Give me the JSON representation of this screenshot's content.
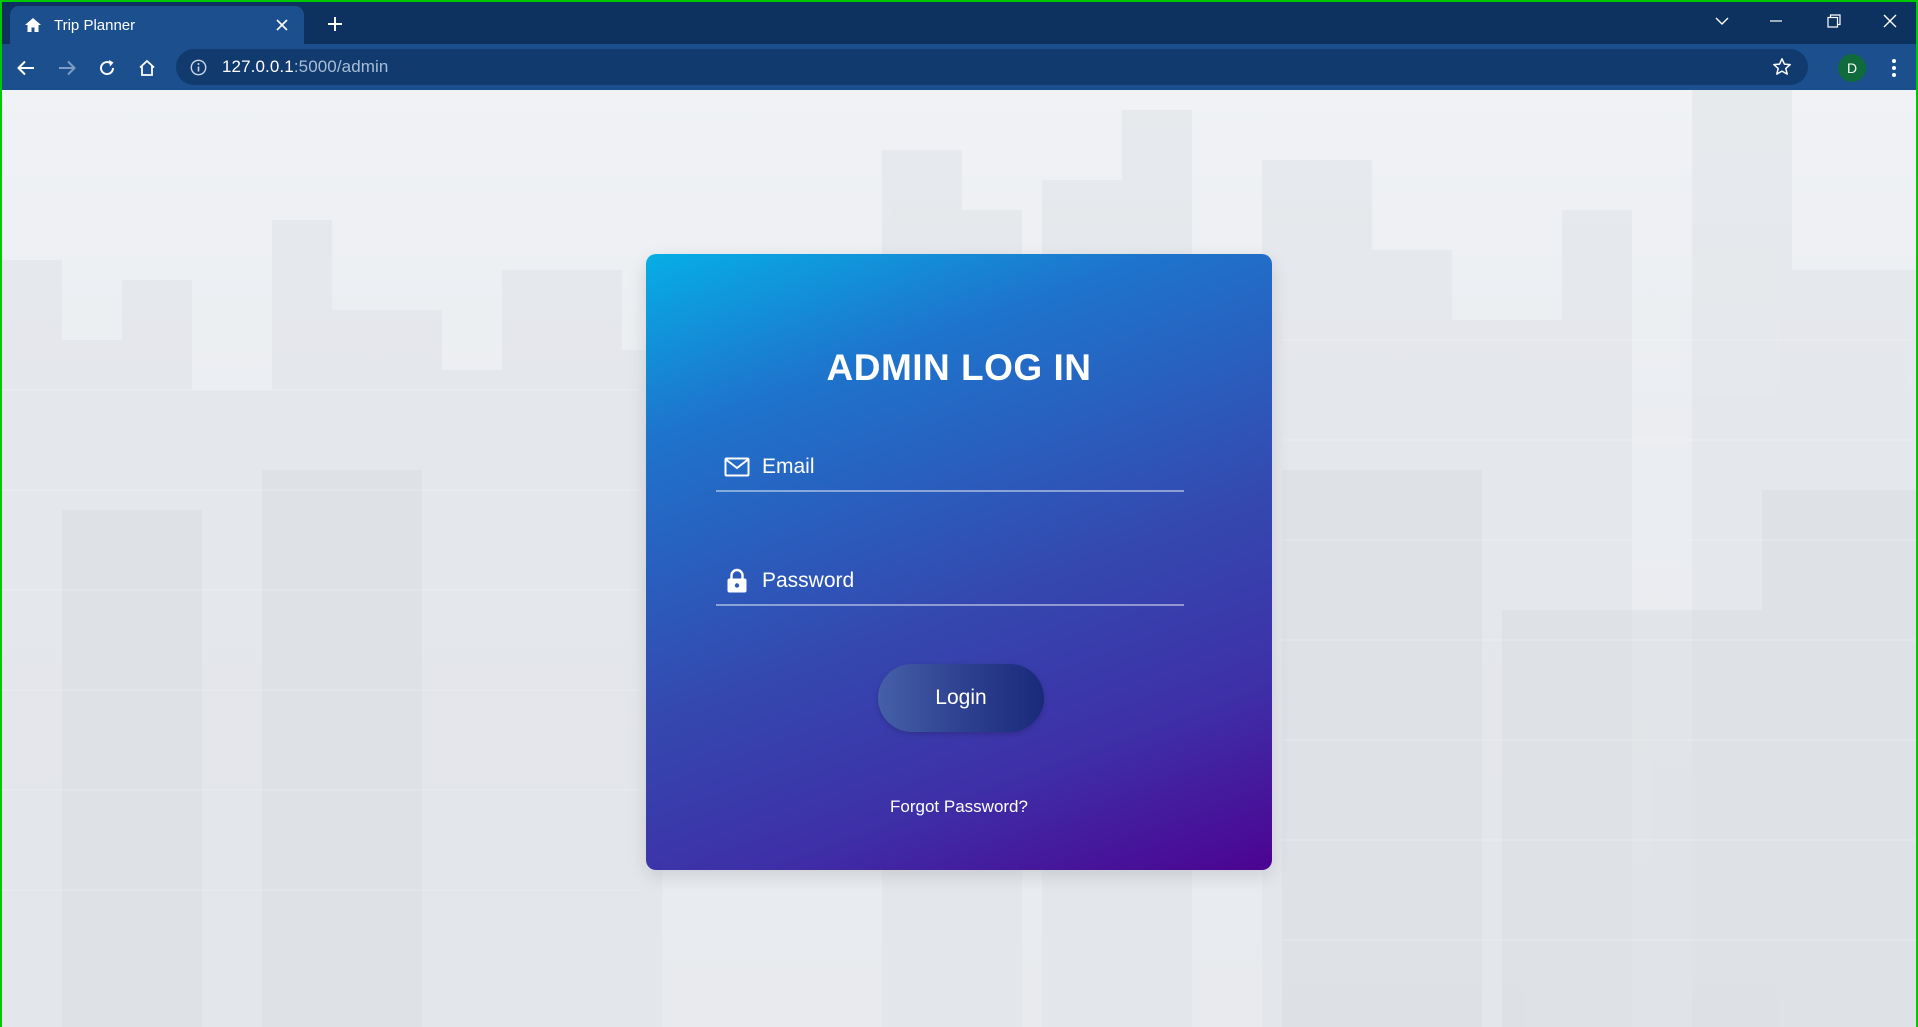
{
  "browser": {
    "tab": {
      "title": "Trip Planner",
      "favicon": "home-icon",
      "close_icon": "close-icon"
    },
    "new_tab_icon": "plus-icon",
    "window_controls": [
      "tab-search-icon",
      "minimize-icon",
      "restore-icon",
      "close-icon"
    ],
    "nav": [
      "back-icon",
      "forward-icon",
      "reload-icon",
      "home-icon"
    ],
    "address": {
      "host": "127.0.0.1",
      "path": ":5000/admin",
      "security_icon": "info-icon",
      "bookmark_icon": "star-icon"
    },
    "profile_initial": "D",
    "menu_icon": "more-vert-icon"
  },
  "login": {
    "title": "ADMIN LOG IN",
    "email": {
      "label": "Email",
      "icon": "mail-icon"
    },
    "password": {
      "label": "Password",
      "icon": "lock-icon"
    },
    "submit_label": "Login",
    "forgot_label": "Forgot Password?"
  },
  "colors": {
    "card_gradient_start": "#06aee6",
    "card_gradient_end": "#4c0391",
    "tabstrip": "#0d3260",
    "toolbar": "#1b4f8e"
  }
}
